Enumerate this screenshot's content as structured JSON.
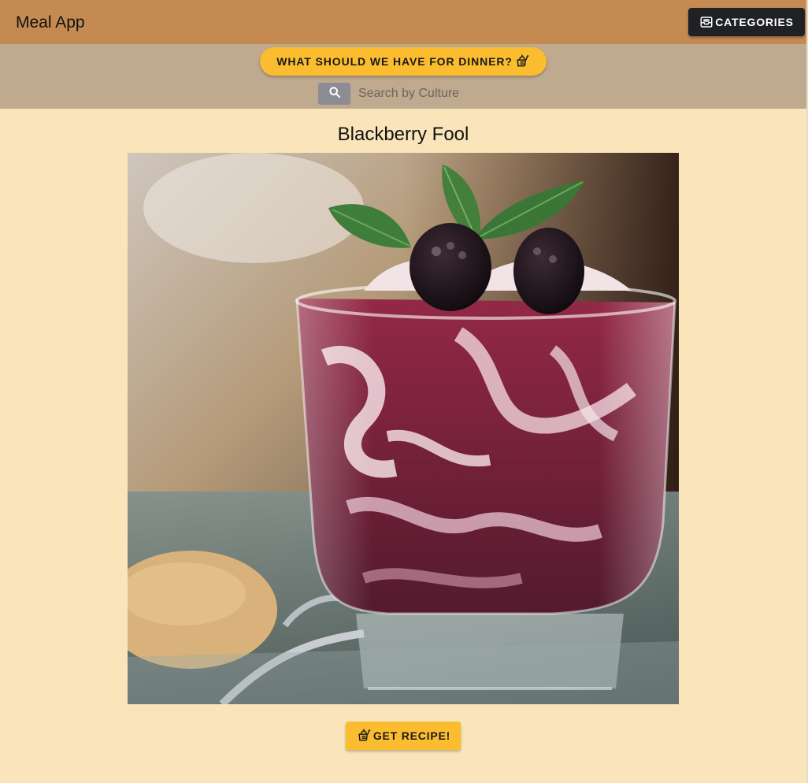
{
  "app": {
    "title": "Meal App"
  },
  "header": {
    "categories_label": "CATEGORIES",
    "categories_icon": "inbox-icon"
  },
  "toolbar": {
    "dinner_label": "WHAT SHOULD WE HAVE FOR DINNER?",
    "dinner_icon": "food-bank-icon",
    "search_icon": "search-icon",
    "search_placeholder": "Search by Culture",
    "search_value": ""
  },
  "meal": {
    "name": "Blackberry Fool",
    "image_alt": "Blackberry Fool in a glass topped with blackberries and mint"
  },
  "actions": {
    "recipe_label": "GET RECIPE!",
    "recipe_icon": "food-bank-icon"
  },
  "colors": {
    "appbar": "#c48a52",
    "subbar": "#bfa98f",
    "background": "#f9e5b9",
    "accent": "#fbbd2f",
    "dark_button": "#1f2125"
  }
}
